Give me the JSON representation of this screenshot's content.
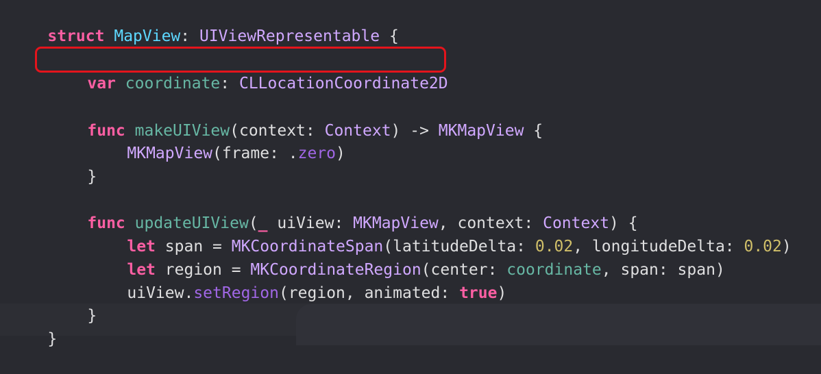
{
  "colors": {
    "background": "#292a30",
    "keyword": "#fc5fa3",
    "type_project": "#5dd8ff",
    "type_other": "#d0a8ff",
    "function_project": "#67b7a4",
    "function_other": "#a167e6",
    "number": "#d0bf69",
    "plain": "#dfdfe0",
    "highlight_border": "#e4141c"
  },
  "code": {
    "l1": [
      "struct",
      " ",
      "MapView",
      ": ",
      "UIViewRepresentable",
      " {"
    ],
    "l2": [
      "var",
      " ",
      "coordinate",
      ": ",
      "CLLocationCoordinate2D"
    ],
    "l3": [
      "func",
      " ",
      "makeUIView",
      "(context: ",
      "Context",
      ") -> ",
      "MKMapView",
      " {"
    ],
    "l4": [
      "MKMapView",
      "(frame: .",
      "zero",
      ")"
    ],
    "l5": [
      "}"
    ],
    "l6": [
      "func",
      " ",
      "updateUIView",
      "(",
      "_",
      " uiView: ",
      "MKMapView",
      ", context: ",
      "Context",
      ") {"
    ],
    "l7": [
      "let",
      " span = ",
      "MKCoordinateSpan",
      "(latitudeDelta: ",
      "0.02",
      ", longitudeDelta: ",
      "0.02",
      ")"
    ],
    "l8": [
      "let",
      " region = ",
      "MKCoordinateRegion",
      "(center: ",
      "coordinate",
      ", span: span)"
    ],
    "l9": [
      "uiView.",
      "setRegion",
      "(region, animated: ",
      "true",
      ")"
    ],
    "l10": [
      "}"
    ],
    "l11": [
      "}"
    ]
  }
}
